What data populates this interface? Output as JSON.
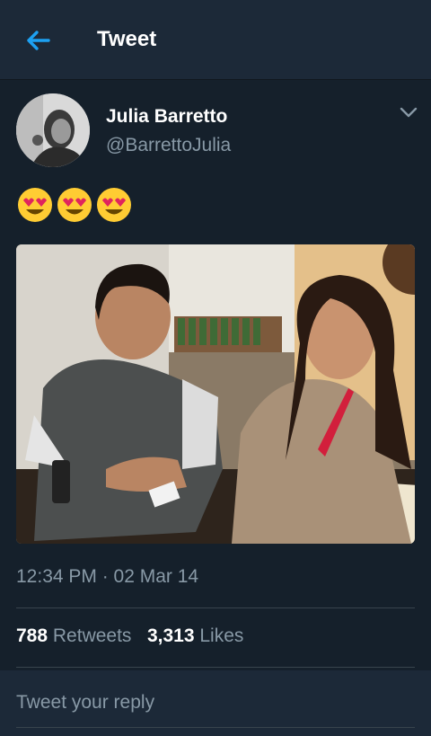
{
  "header": {
    "title": "Tweet",
    "back_icon": "arrow-left-icon",
    "accent": "#1da1f2"
  },
  "tweet": {
    "author_name": "Julia Barretto",
    "author_handle": "@BarrettoJulia",
    "menu_icon": "chevron-down-icon",
    "emojis": [
      "heart-eyes-emoji",
      "heart-eyes-emoji",
      "heart-eyes-emoji"
    ],
    "photo": "photo of two smiling people seated at a restaurant table",
    "timestamp": "12:34 PM · 02 Mar 14"
  },
  "stats": {
    "retweets_count": "788",
    "retweets_label": "Retweets",
    "likes_count": "3,313",
    "likes_label": "Likes"
  },
  "reply": {
    "placeholder": "Tweet your reply"
  },
  "colors": {
    "background": "#15202b",
    "header": "#1c2938",
    "muted": "#8899a6",
    "divider": "#38444d"
  }
}
